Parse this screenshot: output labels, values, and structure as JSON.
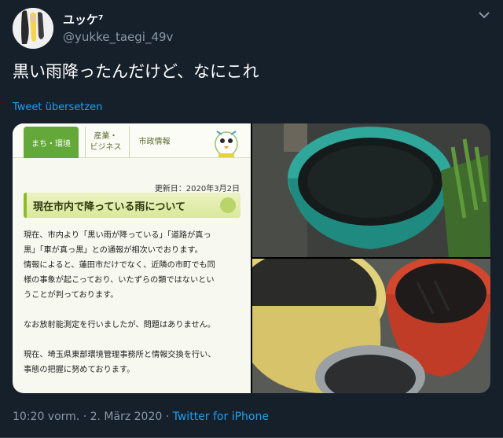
{
  "author": {
    "display_name": "ユッケ⁷",
    "handle": "@yukke_taegi_49v"
  },
  "tweet": {
    "text": "黒い雨降ったんだけど、なにこれ",
    "translate_label": "Tweet übersetzen"
  },
  "website": {
    "nav": [
      "まち・環境",
      "産業・\nビジネス",
      "市政情報"
    ],
    "updated": "更新日：2020年3月2日",
    "heading": "現在市内で降っている雨について",
    "paragraphs": [
      "現在、市内より「黒い雨が降っている」「道路が真っ\n黒」「車が真っ黒」との通報が相次いでおります。\n情報によると、蓮田市だけでなく、近隣の市町でも同\n様の事象が起こっており、いたずらの類ではないとい\nうことが判っております。",
      "なお放射能測定を行いましたが、問題はありません。",
      "現在、埼玉県東部環境管理事務所と情報交換を行い、\n事態の把握に努めております。"
    ]
  },
  "meta": {
    "time": "10:20 vorm.",
    "separator": " · ",
    "date": "2. März 2020",
    "source": "Twitter for iPhone"
  },
  "icons": {
    "more": "chevron-down-icon",
    "avatar": "avatar"
  },
  "colors": {
    "background": "#15202b",
    "link": "#1da1f2",
    "secondary_text": "#8899a6",
    "site_accent": "#64a83a"
  }
}
